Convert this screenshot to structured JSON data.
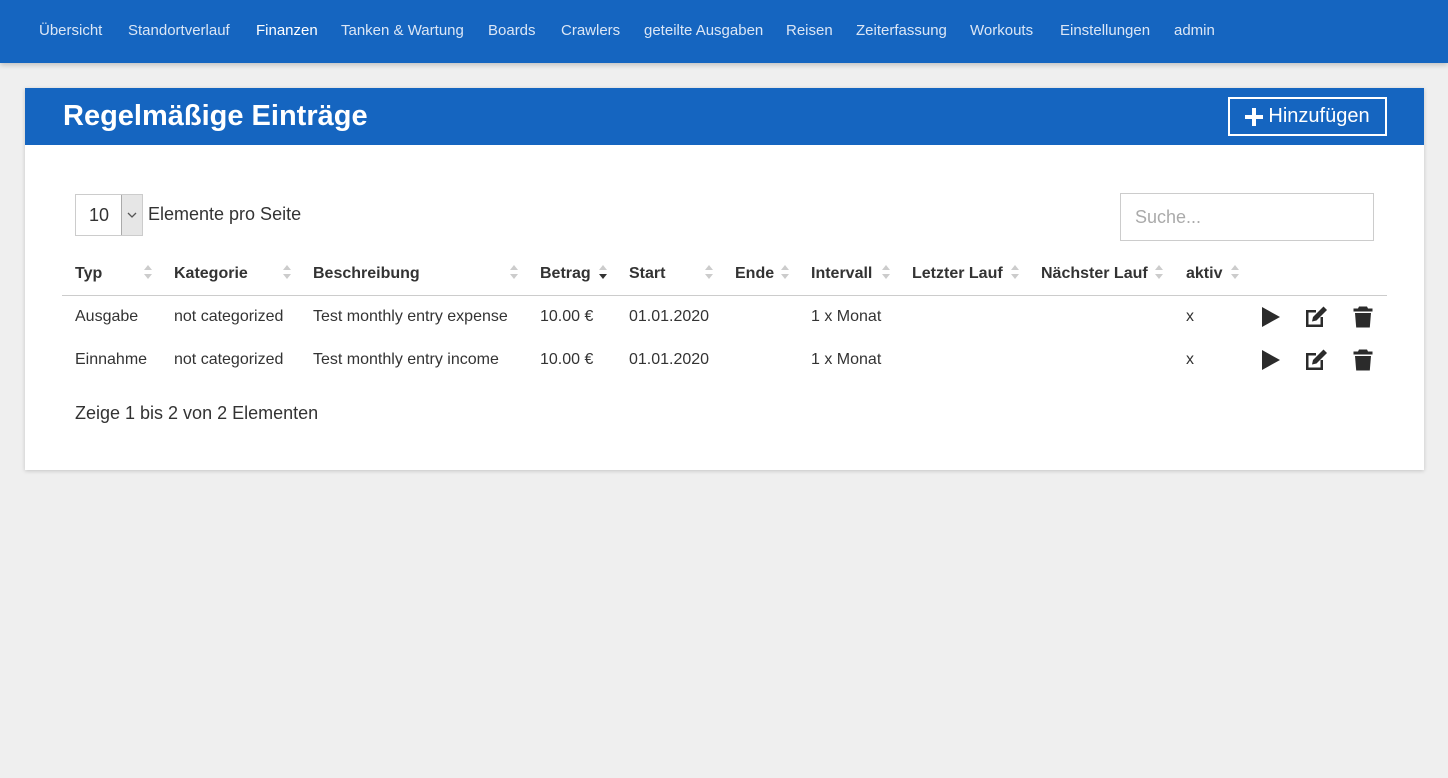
{
  "nav": {
    "items": [
      "Übersicht",
      "Standortverlauf",
      "Finanzen",
      "Tanken & Wartung",
      "Boards",
      "Crawlers",
      "geteilte Ausgaben",
      "Reisen",
      "Zeiterfassung",
      "Workouts",
      "Einstellungen",
      "admin"
    ],
    "active": "Finanzen"
  },
  "card": {
    "title": "Regelmäßige Einträge",
    "add_label": "Hinzufügen"
  },
  "controls": {
    "per_page_value": "10",
    "per_page_label": "Elemente pro Seite",
    "search_placeholder": "Suche..."
  },
  "table": {
    "columns": [
      "Typ",
      "Kategorie",
      "Beschreibung",
      "Betrag",
      "Start",
      "Ende",
      "Intervall",
      "Letzter Lauf",
      "Nächster Lauf",
      "aktiv"
    ],
    "sorted_column": "Betrag",
    "sort_direction": "descending",
    "rows": [
      {
        "typ": "Ausgabe",
        "kategorie": "not categorized",
        "beschreibung": "Test monthly entry expense",
        "betrag": "10.00 €",
        "start": "01.01.2020",
        "ende": "",
        "intervall": "1 x Monat",
        "letzter_lauf": "",
        "naechster_lauf": "",
        "aktiv": "x"
      },
      {
        "typ": "Einnahme",
        "kategorie": "not categorized",
        "beschreibung": "Test monthly entry income",
        "betrag": "10.00 €",
        "start": "01.01.2020",
        "ende": "",
        "intervall": "1 x Monat",
        "letzter_lauf": "",
        "naechster_lauf": "",
        "aktiv": "x"
      }
    ],
    "row_actions": [
      "play-icon",
      "edit-icon",
      "trash-icon"
    ]
  },
  "info_text": "Zeige 1 bis 2 von 2 Elementen",
  "colors": {
    "primary": "#1565c0",
    "background": "#efefef"
  }
}
